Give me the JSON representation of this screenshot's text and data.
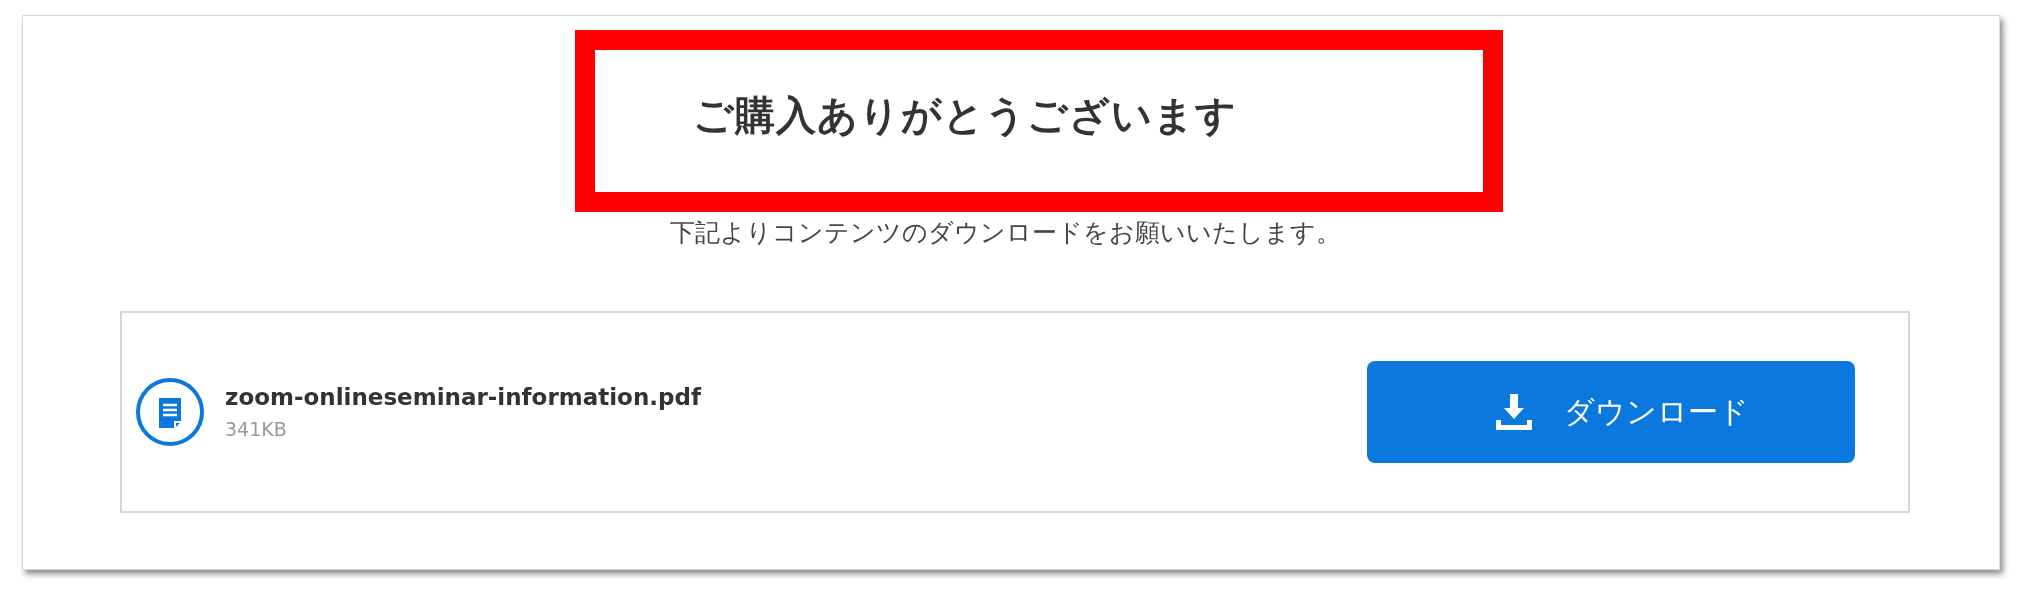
{
  "heading": "ご購入ありがとうございます",
  "subtitle": "下記よりコンテンツのダウンロードをお願いいたします。",
  "file": {
    "name": "zoom-onlineseminar-information.pdf",
    "size": "341KB"
  },
  "download_button": {
    "label": "ダウンロード"
  }
}
